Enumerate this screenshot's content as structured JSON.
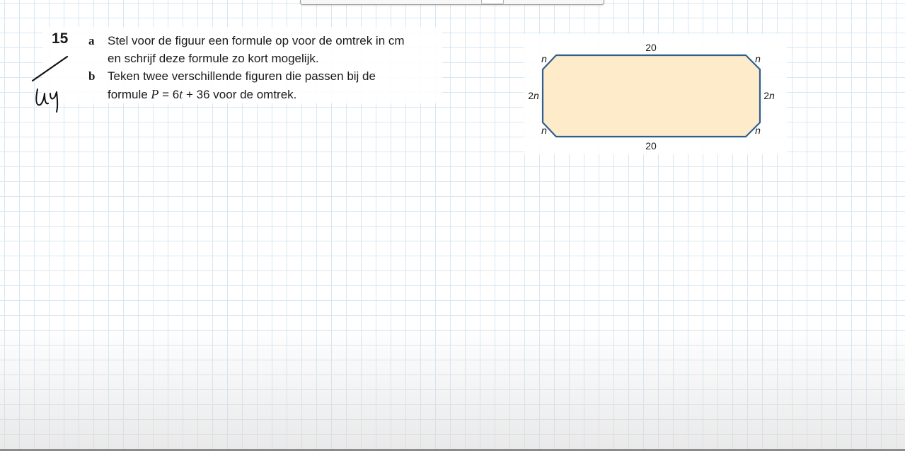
{
  "exercise": {
    "number": "15",
    "parts": [
      {
        "letter": "a",
        "lines": [
          "Stel voor de figuur een formule op voor de omtrek in cm",
          "en schrijf deze formule zo kort mogelijk."
        ]
      },
      {
        "letter": "b",
        "line1": "Teken twee verschillende figuren die passen bij de",
        "line2_prefix": "formule ",
        "line2_var_p": "P",
        "line2_mid": " = 6",
        "line2_var_t": "t",
        "line2_suffix": " + 36 voor de omtrek."
      }
    ]
  },
  "handwriting": {
    "note": "Uy"
  },
  "figure": {
    "fill_color": "#fdebc9",
    "stroke_color": "#2f5f8f",
    "labels": {
      "top": "20",
      "bottom": "20",
      "top_left_corner": "n",
      "top_right_corner": "n",
      "bottom_left_corner": "n",
      "bottom_right_corner": "n",
      "left_side_num": "2",
      "left_side_var": "n",
      "right_side_num": "2",
      "right_side_var": "n"
    }
  }
}
